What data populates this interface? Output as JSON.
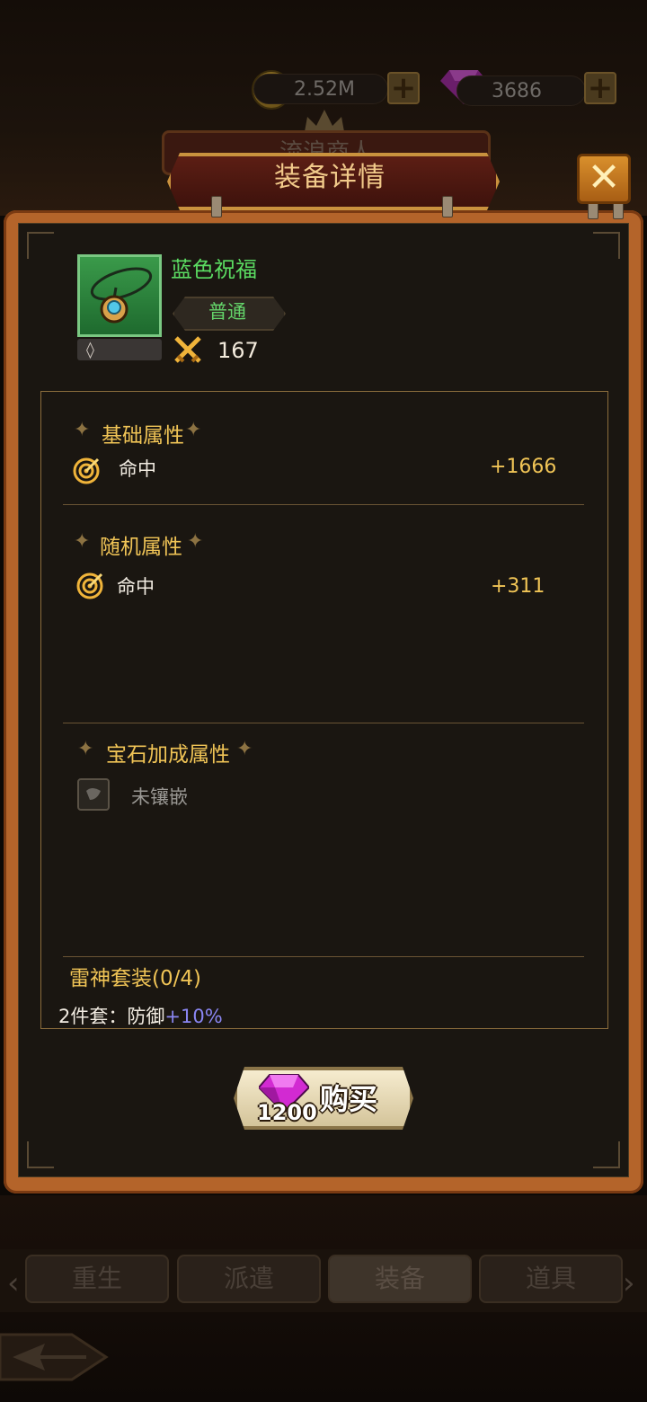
{
  "currency": {
    "gold": "2.52M",
    "gems": "3686"
  },
  "underlay": {
    "shop_title": "流浪商人"
  },
  "dialog": {
    "title": "装备详情"
  },
  "item": {
    "name": "蓝色祝福",
    "rarity": "普通",
    "power": "167",
    "slot_glyph": "◊",
    "name_color": "#5bdc62"
  },
  "sections": {
    "base": {
      "title": "基础属性",
      "attrs": [
        {
          "label": "命中",
          "value": "+1666",
          "icon": "target-icon"
        }
      ]
    },
    "random": {
      "title": "随机属性",
      "attrs": [
        {
          "label": "命中",
          "value": "+311",
          "icon": "target-icon"
        }
      ]
    },
    "gem": {
      "title": "宝石加成属性",
      "empty_text": "未镶嵌"
    },
    "set": {
      "title": "雷神套装(0/4)",
      "bonus_prefix": "2件套：防御",
      "bonus_value": "+10%"
    }
  },
  "buy_button": {
    "label": "购买",
    "price": "1200",
    "currency_icon": "gem-icon"
  },
  "tabs": [
    {
      "label": "重生",
      "active": false
    },
    {
      "label": "派遣",
      "active": false
    },
    {
      "label": "装备",
      "active": true
    },
    {
      "label": "道具",
      "active": false
    }
  ],
  "colors": {
    "accent_gold": "#f0c456",
    "panel_border": "#b4642a",
    "rarity_green": "#64d46a",
    "set_bonus_highlight": "#8a86f2"
  }
}
